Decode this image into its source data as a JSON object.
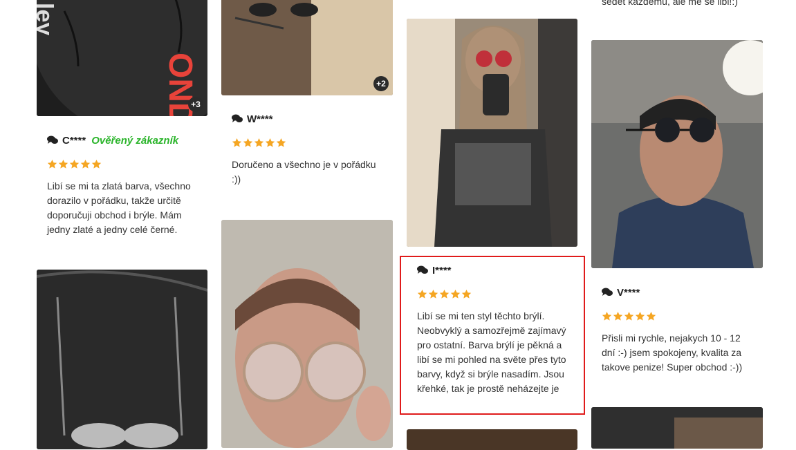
{
  "reviews": [
    {
      "author": "C****",
      "verified": "Ověřený zákazník",
      "rating": 5,
      "text": "Libí se mi ta zlatá barva, všechno\ndorazilo v pořádku, takže určitě\ndoporučuji obchod i brýle. Mám\njedny zlaté a jedny celé černé.",
      "more_photos": "+3"
    },
    {
      "author": "W****",
      "verified": "",
      "rating": 5,
      "text": "Doručeno a všechno je v pořádku\n:))",
      "more_photos": "+2"
    },
    {
      "author": "I****",
      "verified": "",
      "rating": 5,
      "text": "Libí se mi ten styl těchto brýlí.\nNeobvyklý a samozřejmě zajímavý\npro ostatní. Barva brýlí je pěkná a\nlibí se mi pohled na světe přes tyto\nbarvy, když si brýle nasadím. Jsou\nkřehké, tak je prostě neházejte je"
    },
    {
      "author": "V****",
      "verified": "",
      "rating": 5,
      "text": "Přisli mi rychle, nejakych 10 - 12\ndní :-) jsem spokojeny, kvalita za\ntakove penize! Super obchod :-))"
    }
  ],
  "top_fragment": "sedet kazdemu, ale me se libi!:)",
  "colors": {
    "star": "#f5a623",
    "verified": "#2ab42a",
    "highlight": "#e01b1b"
  },
  "icons": {
    "author": "comments-icon",
    "rating": "star-icon",
    "more": "photo-count-badge"
  }
}
